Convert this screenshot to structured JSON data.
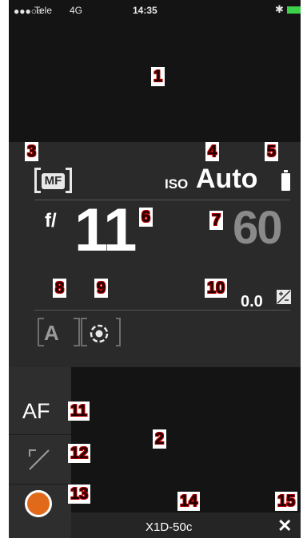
{
  "status_bar": {
    "signal": "●●●○○",
    "carrier": "Tele",
    "network": "4G",
    "time": "14:35",
    "bluetooth_icon": "bluetooth-icon",
    "battery_color": "#3bd14a"
  },
  "badges": [
    "1",
    "2",
    "3",
    "4",
    "5",
    "6",
    "7",
    "8",
    "9",
    "10",
    "11",
    "12",
    "13",
    "14",
    "15"
  ],
  "focus_mode": "MF",
  "iso": {
    "label": "ISO",
    "value": "Auto"
  },
  "aperture": {
    "prefix": "f/",
    "value": "11"
  },
  "shutter": {
    "value": "60"
  },
  "exposure_comp": {
    "value": "0.0",
    "icon": "ev-compensation-icon"
  },
  "exposure_mode": "A",
  "metering_icon": "spot-metering-icon",
  "sidebar": {
    "af_label": "AF",
    "curve_icon": "line-diagonal-icon",
    "record_icon": "record-icon",
    "record_color": "#e06a1a"
  },
  "bottom_bar": {
    "device_name": "X1D-50c",
    "close_label": "✕"
  }
}
